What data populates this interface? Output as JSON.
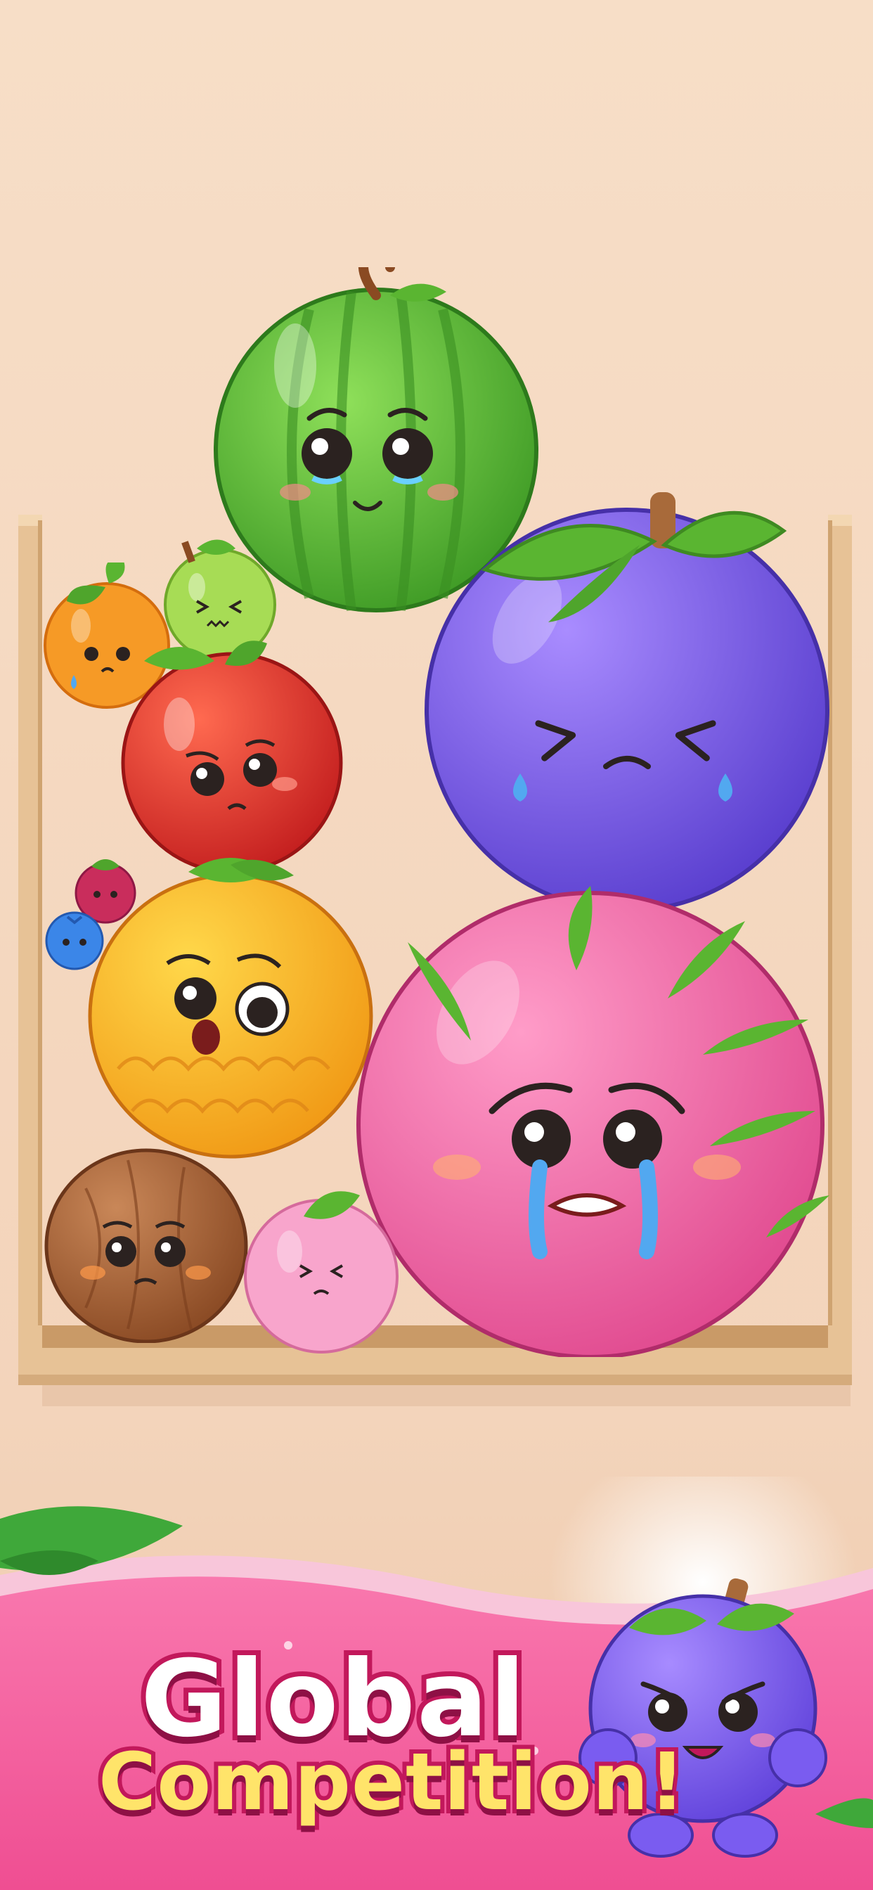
{
  "headline": {
    "line1": "Global",
    "line2": "Competition!"
  },
  "fruits": [
    {
      "name": "watermelon",
      "color": "#5fbf3a",
      "mood": "teary"
    },
    {
      "name": "mangosteen",
      "color": "#7a5ce6",
      "mood": "crying"
    },
    {
      "name": "dragon-fruit",
      "color": "#f06aa8",
      "mood": "crying"
    },
    {
      "name": "pineapple",
      "color": "#f9b52a",
      "mood": "shocked"
    },
    {
      "name": "apple",
      "color": "#e63a32",
      "mood": "sad"
    },
    {
      "name": "orange",
      "color": "#f6951f",
      "mood": "sweating"
    },
    {
      "name": "pear",
      "color": "#9fd64a",
      "mood": "dizzy"
    },
    {
      "name": "coconut",
      "color": "#a8653e",
      "mood": "worried"
    },
    {
      "name": "peach",
      "color": "#f79bc8",
      "mood": "dizzy"
    },
    {
      "name": "cherry",
      "color": "#c72b5a",
      "mood": "blush"
    },
    {
      "name": "blueberry",
      "color": "#3b86e8",
      "mood": "sad"
    }
  ],
  "mascot": {
    "name": "grape-mascot",
    "color": "#7b5cf0"
  },
  "colors": {
    "background": "#f6dcc4",
    "box": "#e8c49a",
    "banner": "#f56fa6",
    "leaf": "#5ab531"
  }
}
